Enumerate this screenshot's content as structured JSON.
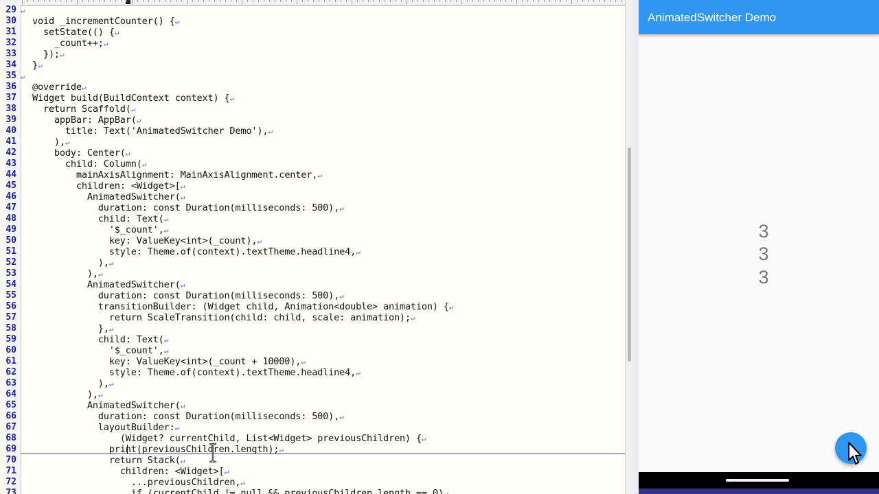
{
  "editor": {
    "lines": [
      {
        "n": "29",
        "code": ""
      },
      {
        "n": "30",
        "code": "void _incrementCounter() {"
      },
      {
        "n": "31",
        "code": "  setState(() {"
      },
      {
        "n": "32",
        "code": "    _count++;"
      },
      {
        "n": "33",
        "code": "  });"
      },
      {
        "n": "34",
        "code": "}"
      },
      {
        "n": "35",
        "code": ""
      },
      {
        "n": "36",
        "code": "@override"
      },
      {
        "n": "37",
        "code": "Widget build(BuildContext context) {"
      },
      {
        "n": "38",
        "code": "  return Scaffold("
      },
      {
        "n": "39",
        "code": "    appBar: AppBar("
      },
      {
        "n": "40",
        "code": "      title: Text('AnimatedSwitcher Demo'),"
      },
      {
        "n": "41",
        "code": "    ),"
      },
      {
        "n": "42",
        "code": "    body: Center("
      },
      {
        "n": "43",
        "code": "      child: Column("
      },
      {
        "n": "44",
        "code": "        mainAxisAlignment: MainAxisAlignment.center,"
      },
      {
        "n": "45",
        "code": "        children: <Widget>["
      },
      {
        "n": "46",
        "code": "          AnimatedSwitcher("
      },
      {
        "n": "47",
        "code": "            duration: const Duration(milliseconds: 500),"
      },
      {
        "n": "48",
        "code": "            child: Text("
      },
      {
        "n": "49",
        "code": "              '$_count',"
      },
      {
        "n": "50",
        "code": "              key: ValueKey<int>(_count),"
      },
      {
        "n": "51",
        "code": "              style: Theme.of(context).textTheme.headline4,"
      },
      {
        "n": "52",
        "code": "            ),"
      },
      {
        "n": "53",
        "code": "          ),"
      },
      {
        "n": "54",
        "code": "          AnimatedSwitcher("
      },
      {
        "n": "55",
        "code": "            duration: const Duration(milliseconds: 500),"
      },
      {
        "n": "56",
        "code": "            transitionBuilder: (Widget child, Animation<double> animation) {"
      },
      {
        "n": "57",
        "code": "              return ScaleTransition(child: child, scale: animation);"
      },
      {
        "n": "58",
        "code": "            },"
      },
      {
        "n": "59",
        "code": "            child: Text("
      },
      {
        "n": "60",
        "code": "              '$_count',"
      },
      {
        "n": "61",
        "code": "              key: ValueKey<int>(_count + 10000),"
      },
      {
        "n": "62",
        "code": "              style: Theme.of(context).textTheme.headline4,"
      },
      {
        "n": "63",
        "code": "            ),"
      },
      {
        "n": "64",
        "code": "          ),"
      },
      {
        "n": "65",
        "code": "          AnimatedSwitcher("
      },
      {
        "n": "66",
        "code": "            duration: const Duration(milliseconds: 500),"
      },
      {
        "n": "67",
        "code": "            layoutBuilder:"
      },
      {
        "n": "68",
        "code": "                (Widget? currentChild, List<Widget> previousChildren) {"
      },
      {
        "n": "69",
        "code": "              print(previousChildren.length);"
      },
      {
        "n": "70",
        "code": "              return Stack("
      },
      {
        "n": "71",
        "code": "                children: <Widget>["
      },
      {
        "n": "72",
        "code": "                  ...previousChildren,"
      },
      {
        "n": "73",
        "code": "                  if (currentChild != null && previousChildren.length == 0)"
      }
    ],
    "return_mark": "↵",
    "eof_mark": "↵"
  },
  "app": {
    "title": "AnimatedSwitcher Demo",
    "counters": [
      "3",
      "3",
      "3"
    ]
  },
  "colors": {
    "appbar": "#2f97f3",
    "fab": "#2f97f3",
    "line_numbers": "#1a1aa6",
    "editor_bg": "#fffff7"
  },
  "icons": {
    "fab": "add-icon",
    "pointer": "mouse-pointer-icon",
    "text_cursor": "ibeam-cursor-icon"
  }
}
